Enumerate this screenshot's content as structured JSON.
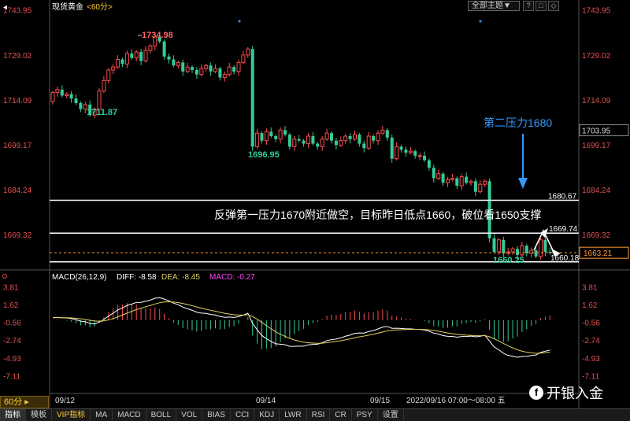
{
  "header": {
    "title": "现货黄金",
    "period_tag": "<60分>",
    "theme_select": "全部主题▼",
    "win_buttons": [
      "?",
      "□",
      "◇"
    ]
  },
  "watermark": {
    "text": "开银入金",
    "icon": "f-logo-icon"
  },
  "period_selector": "60分 ▸",
  "toolbar": [
    "指标",
    "模板",
    "VIP指标",
    "MA",
    "MACD",
    "BOLL",
    "VOL",
    "BIAS",
    "CCI",
    "KDJ",
    "LWR",
    "RSI",
    "CR",
    "PSY",
    "设置"
  ],
  "colors": {
    "up": "#ff4d4d",
    "down": "#33cc99",
    "white": "#ffffff",
    "yellow": "#e0d060",
    "magenta": "#ff44ff",
    "blue": "#3399ff",
    "orange": "#ff9933"
  },
  "chart_data": [
    {
      "type": "candlestick",
      "title": "现货黄金",
      "ylim": [
        1657.5,
        1746.5
      ],
      "y_ticks": [
        "1743.95",
        "1729.02",
        "1714.09",
        "1699.17",
        "1684.24",
        "1669.32"
      ],
      "x_labels": [
        "09/12",
        "09/14",
        "09/15"
      ],
      "current_price": "1663.21",
      "right_marker": "1703.95",
      "close_series": [
        1716.5,
        1717.5,
        1715.5,
        1716,
        1714.5,
        1713,
        1711,
        1712.5,
        1709,
        1711,
        1717,
        1720.5,
        1724,
        1725,
        1727.5,
        1726,
        1729.5,
        1728,
        1730,
        1727,
        1730.5,
        1732,
        1735,
        1733.5,
        1728.5,
        1727.5,
        1725.5,
        1726.5,
        1723.5,
        1725,
        1724,
        1722.5,
        1724.5,
        1725.5,
        1723.5,
        1724.5,
        1721.5,
        1722.5,
        1725,
        1723.5,
        1726.5,
        1729,
        1731,
        1698.5,
        1703,
        1700.5,
        1703.5,
        1702,
        1701,
        1704,
        1702.5,
        1698.5,
        1701,
        1700.5,
        1699.5,
        1702,
        1699.5,
        1698.5,
        1701,
        1703,
        1700.5,
        1699,
        1700.5,
        1702,
        1701,
        1702.5,
        1699.5,
        1698,
        1702,
        1700.5,
        1703,
        1704,
        1701.5,
        1694.5,
        1698.5,
        1697.5,
        1696.5,
        1697,
        1695.5,
        1695.5,
        1694,
        1691.5,
        1688,
        1689.5,
        1686.5,
        1687.5,
        1688,
        1685.5,
        1688.5,
        1686.5,
        1687,
        1683.5,
        1686,
        1687,
        1668,
        1663.5,
        1667.5,
        1663,
        1663.5,
        1664.5,
        1662.5,
        1665.5,
        1663,
        1664,
        1662,
        1667.5,
        1663.5,
        1663.21
      ],
      "annotations": [
        {
          "label": "1734.98",
          "color": "#ff6666"
        },
        {
          "label": "1711.87",
          "color": "#33cc99"
        },
        {
          "label": "1696.95",
          "color": "#33cc99"
        },
        {
          "label": "1660.25",
          "color": "#33cc99"
        },
        {
          "label": "第二压力1680",
          "color": "#3399ff"
        },
        {
          "label": "反弹第一压力1670附近做空，目标昨日低点1660，破位看1650支撑",
          "color": "#ffffff"
        }
      ],
      "levels": [
        {
          "value": 1680.67,
          "label": "1680.67"
        },
        {
          "value": 1669.74,
          "label": "1669.74"
        },
        {
          "value": 1660.18,
          "label": "1660.18"
        }
      ],
      "dashed_level": 1663.21
    },
    {
      "type": "bar+line",
      "title": "MACD(26,12,9)",
      "legend": [
        {
          "label": "DIFF: -8.58",
          "color": "#ffffff"
        },
        {
          "label": "DEA: -8.45",
          "color": "#e0d060"
        },
        {
          "label": "MACD: -0.27",
          "color": "#ff44ff"
        }
      ],
      "ylim": [
        -9.3,
        5.0
      ],
      "y_ticks": [
        "3.81",
        "1.62",
        "-0.56",
        "-2.74",
        "-4.93",
        "-7.11"
      ],
      "footer": "2022/09/16 07:00～08:00 五"
    }
  ]
}
